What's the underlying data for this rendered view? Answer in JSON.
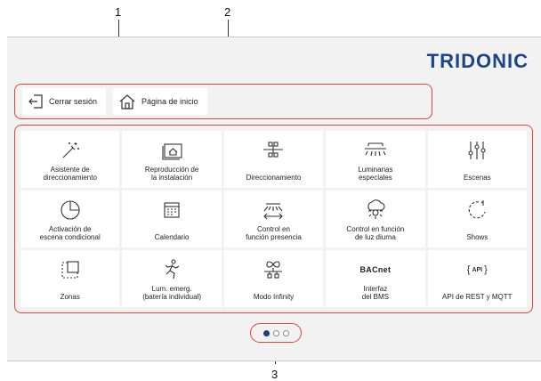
{
  "callouts": [
    "1",
    "2",
    "3"
  ],
  "brand": {
    "logo_text": "TRIDONIC",
    "color": "#1c4489"
  },
  "nav": {
    "logout_label": "Cerrar sesión",
    "home_label": "Página de inicio"
  },
  "tiles": [
    {
      "label": "Asistente de\ndireccionamiento",
      "icon": "magic-wand-icon"
    },
    {
      "label": "Reproducción de\nla instalación",
      "icon": "home-screen-icon"
    },
    {
      "label": "Direccionamiento",
      "icon": "network-tree-icon"
    },
    {
      "label": "Luminarias\nespeciales",
      "icon": "special-luminaire-icon"
    },
    {
      "label": "Escenas",
      "icon": "sliders-icon"
    },
    {
      "label": "Activación de\nescena condicional",
      "icon": "clock-icon"
    },
    {
      "label": "Calendario",
      "icon": "calendar-icon"
    },
    {
      "label": "Control en\nfunción presencia",
      "icon": "presence-icon"
    },
    {
      "label": "Control en función\nde luz diurna",
      "icon": "daylight-icon"
    },
    {
      "label": "Shows",
      "icon": "shows-icon"
    },
    {
      "label": "Zonas",
      "icon": "zones-icon"
    },
    {
      "label": "Lum. emerg.\n(batería individual)",
      "icon": "emergency-exit-icon"
    },
    {
      "label": "Modo Infinity",
      "icon": "infinity-network-icon"
    },
    {
      "label": "Interfaz\ndel BMS",
      "icon": "bacnet-icon",
      "icon_text": "BACnet"
    },
    {
      "label": "API de REST y MQTT",
      "icon": "api-icon",
      "icon_text": "API"
    }
  ],
  "pager": {
    "pages": 3,
    "active": 1
  },
  "highlight_color": "#e2453c"
}
